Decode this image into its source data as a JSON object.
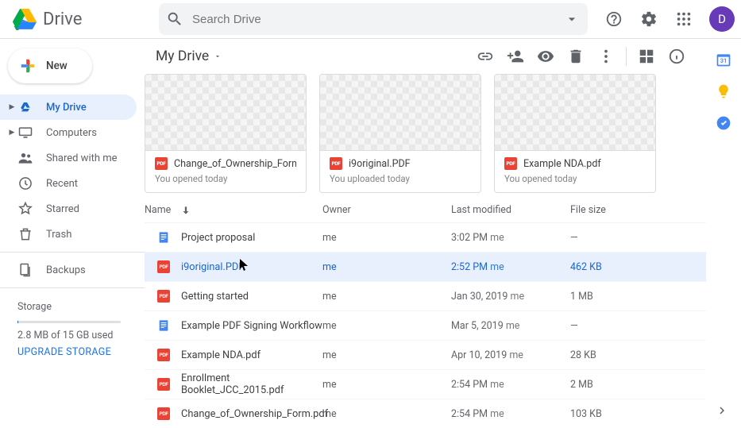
{
  "header": {
    "app_name": "Drive",
    "search_placeholder": "Search Drive",
    "avatar_letter": "D"
  },
  "new_button_label": "New",
  "sidebar": {
    "items": [
      {
        "label": "My Drive",
        "icon": "drive",
        "active": true,
        "expandable": true
      },
      {
        "label": "Computers",
        "icon": "computers",
        "active": false,
        "expandable": true
      },
      {
        "label": "Shared with me",
        "icon": "shared",
        "active": false
      },
      {
        "label": "Recent",
        "icon": "recent",
        "active": false
      },
      {
        "label": "Starred",
        "icon": "starred",
        "active": false
      },
      {
        "label": "Trash",
        "icon": "trash",
        "active": false
      },
      {
        "label": "Backups",
        "icon": "backups",
        "active": false
      }
    ],
    "storage_label": "Storage",
    "storage_used": "2.8 MB of 15 GB used",
    "upgrade_label": "UPGRADE STORAGE"
  },
  "breadcrumb": "My Drive",
  "quick_access": [
    {
      "name": "Change_of_Ownership_Form.pdf",
      "sub": "You opened today",
      "type": "pdf"
    },
    {
      "name": "i9original.PDF",
      "sub": "You uploaded today",
      "type": "pdf"
    },
    {
      "name": "Example NDA.pdf",
      "sub": "You opened today",
      "type": "pdf"
    }
  ],
  "columns": {
    "name": "Name",
    "owner": "Owner",
    "modified": "Last modified",
    "size": "File size"
  },
  "files": [
    {
      "name": "Project proposal",
      "owner": "me",
      "modified": "3:02 PM",
      "by": "me",
      "size": "—",
      "type": "doc",
      "selected": false
    },
    {
      "name": "i9original.PDF",
      "owner": "me",
      "modified": "2:52 PM",
      "by": "me",
      "size": "462 KB",
      "type": "pdf",
      "selected": true
    },
    {
      "name": "Getting started",
      "owner": "me",
      "modified": "Jan 30, 2019",
      "by": "me",
      "size": "1 MB",
      "type": "pdf",
      "selected": false
    },
    {
      "name": "Example PDF Signing Workflow",
      "owner": "me",
      "modified": "Mar 5, 2019",
      "by": "me",
      "size": "—",
      "type": "doc",
      "selected": false
    },
    {
      "name": "Example NDA.pdf",
      "owner": "me",
      "modified": "Apr 10, 2019",
      "by": "me",
      "size": "28 KB",
      "type": "pdf",
      "selected": false
    },
    {
      "name": "Enrollment Booklet_JCC_2015.pdf",
      "owner": "me",
      "modified": "2:54 PM",
      "by": "me",
      "size": "2 MB",
      "type": "pdf",
      "selected": false
    },
    {
      "name": "Change_of_Ownership_Form.pdf",
      "owner": "me",
      "modified": "2:54 PM",
      "by": "me",
      "size": "103 KB",
      "type": "pdf",
      "selected": false
    }
  ]
}
